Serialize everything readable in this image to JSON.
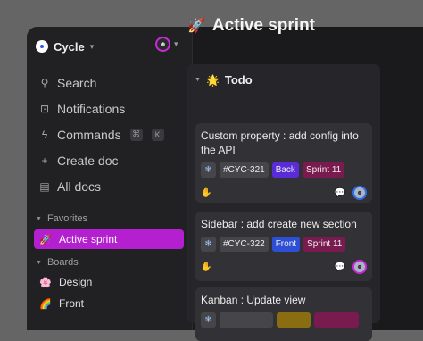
{
  "workspace": {
    "name": "Cycle"
  },
  "nav": {
    "search": "Search",
    "notifications": "Notifications",
    "commands": "Commands",
    "commands_kbd_1": "⌘",
    "commands_kbd_2": "K",
    "create_doc": "Create doc",
    "all_docs": "All docs"
  },
  "favorites": {
    "title": "Favorites",
    "items": [
      {
        "emoji": "🚀",
        "label": "Active sprint",
        "active": true
      }
    ]
  },
  "boards": {
    "title": "Boards",
    "items": [
      {
        "emoji": "🌸",
        "label": "Design"
      },
      {
        "emoji": "🌈",
        "label": "Front"
      }
    ]
  },
  "main": {
    "emoji": "🚀",
    "title": "Active sprint",
    "column": {
      "emoji": "🌟",
      "title": "Todo",
      "cards": [
        {
          "title": "Custom property : add config into the API",
          "id": "#CYC-321",
          "team": "Back",
          "sprint": "Sprint 11"
        },
        {
          "title": "Sidebar : add create new section",
          "id": "#CYC-322",
          "team": "Front",
          "sprint": "Sprint 11"
        },
        {
          "title": "Kanban : Update view"
        }
      ]
    }
  },
  "colors": {
    "accent": "#b41fd0",
    "back_chip": "#5a2bd8",
    "front_chip": "#2d4fd6",
    "sprint_chip": "#7a1b4f"
  }
}
